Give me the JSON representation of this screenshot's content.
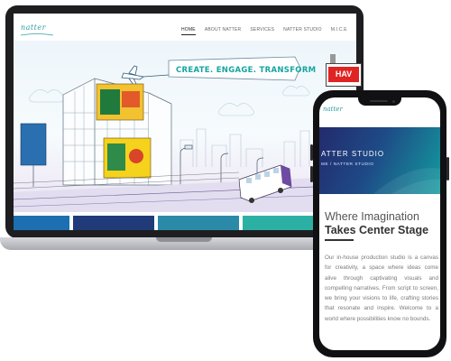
{
  "site": {
    "logo": "natter",
    "nav": [
      "HOME",
      "ABOUT NATTER",
      "SERVICES",
      "NATTER STUDIO",
      "M.I.C.E"
    ],
    "hero_banner": "CREATE. ENGAGE. TRANSFORM",
    "billboard_sign": "HAV"
  },
  "mobile": {
    "logo": "natter",
    "banner_title": "ATTER STUDIO",
    "breadcrumb": "ME / NATTER STUDIO",
    "heading_line1": "Where Imagination",
    "heading_line2": "Takes Center Stage",
    "paragraph": "Our in-house production studio is a canvas for creativity, a space where ideas come alive through captivating visuals and compelling narratives. From script to screen, we bring your visions to life, crafting stories that resonate and inspire. Welcome to a world where possibilities know no bounds."
  },
  "colors": {
    "accent_teal": "#16a4a0",
    "banner_navy": "#232a6d",
    "laptop_frame": "#1e1e20"
  },
  "icons": [
    "airplane-icon"
  ]
}
